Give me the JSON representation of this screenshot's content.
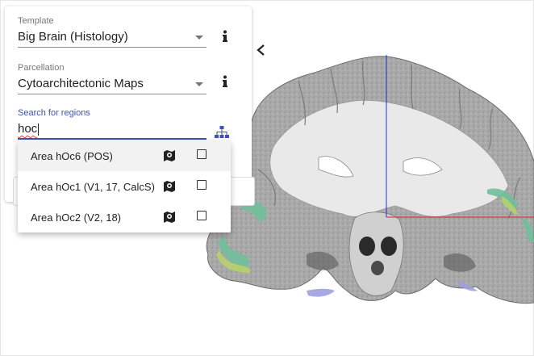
{
  "template": {
    "label": "Template",
    "value": "Big Brain (Histology)"
  },
  "parcellation": {
    "label": "Parcellation",
    "value": "Cytoarchitectonic Maps"
  },
  "search": {
    "label": "Search for regions",
    "value": "hoc"
  },
  "results": [
    {
      "label": "Area hOc6 (POS)",
      "highlighted": true
    },
    {
      "label": "Area hOc1 (V1, 17, CalcS)",
      "highlighted": false
    },
    {
      "label": "Area hOc2 (V2, 18)",
      "highlighted": false
    }
  ],
  "icons": {
    "info": "info-icon",
    "hierarchy": "hierarchy-icon",
    "map": "map-marker-icon",
    "checkbox": "checkbox-icon",
    "back": "chevron-left-icon"
  },
  "colors": {
    "accent": "#3f51b5",
    "crosshair_vertical": "#2233cc",
    "crosshair_horizontal": "#dd2222",
    "region_green": "#6fbf9a",
    "region_lime": "#b5d36a",
    "region_lavender": "#9f9fe0"
  }
}
